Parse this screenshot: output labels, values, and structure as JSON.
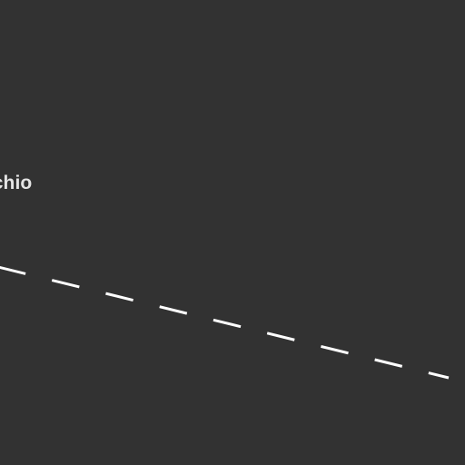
{
  "map": {
    "background_color": "#323232",
    "place_label": "cchio",
    "label_color": "#e4e4e4",
    "boundary_line": {
      "style": "dashed",
      "color": "#ffffff"
    }
  }
}
